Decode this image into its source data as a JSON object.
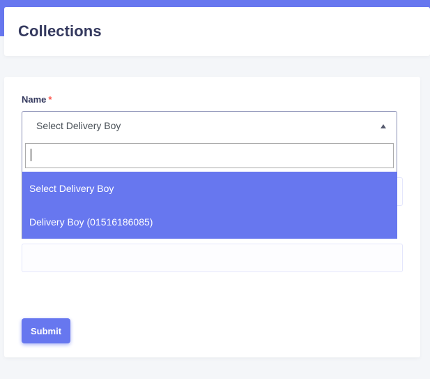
{
  "header": {
    "title": "Collections"
  },
  "form": {
    "name_label": "Name",
    "required_mark": "*",
    "select": {
      "selected_value": "Select Delivery Boy",
      "search_value": "",
      "options": [
        "Select Delivery Boy",
        "Delivery Boy (01516186085)"
      ]
    },
    "submit_label": "Submit"
  },
  "colors": {
    "accent": "#6777ef",
    "required": "#fc544b",
    "title": "#34395e"
  }
}
